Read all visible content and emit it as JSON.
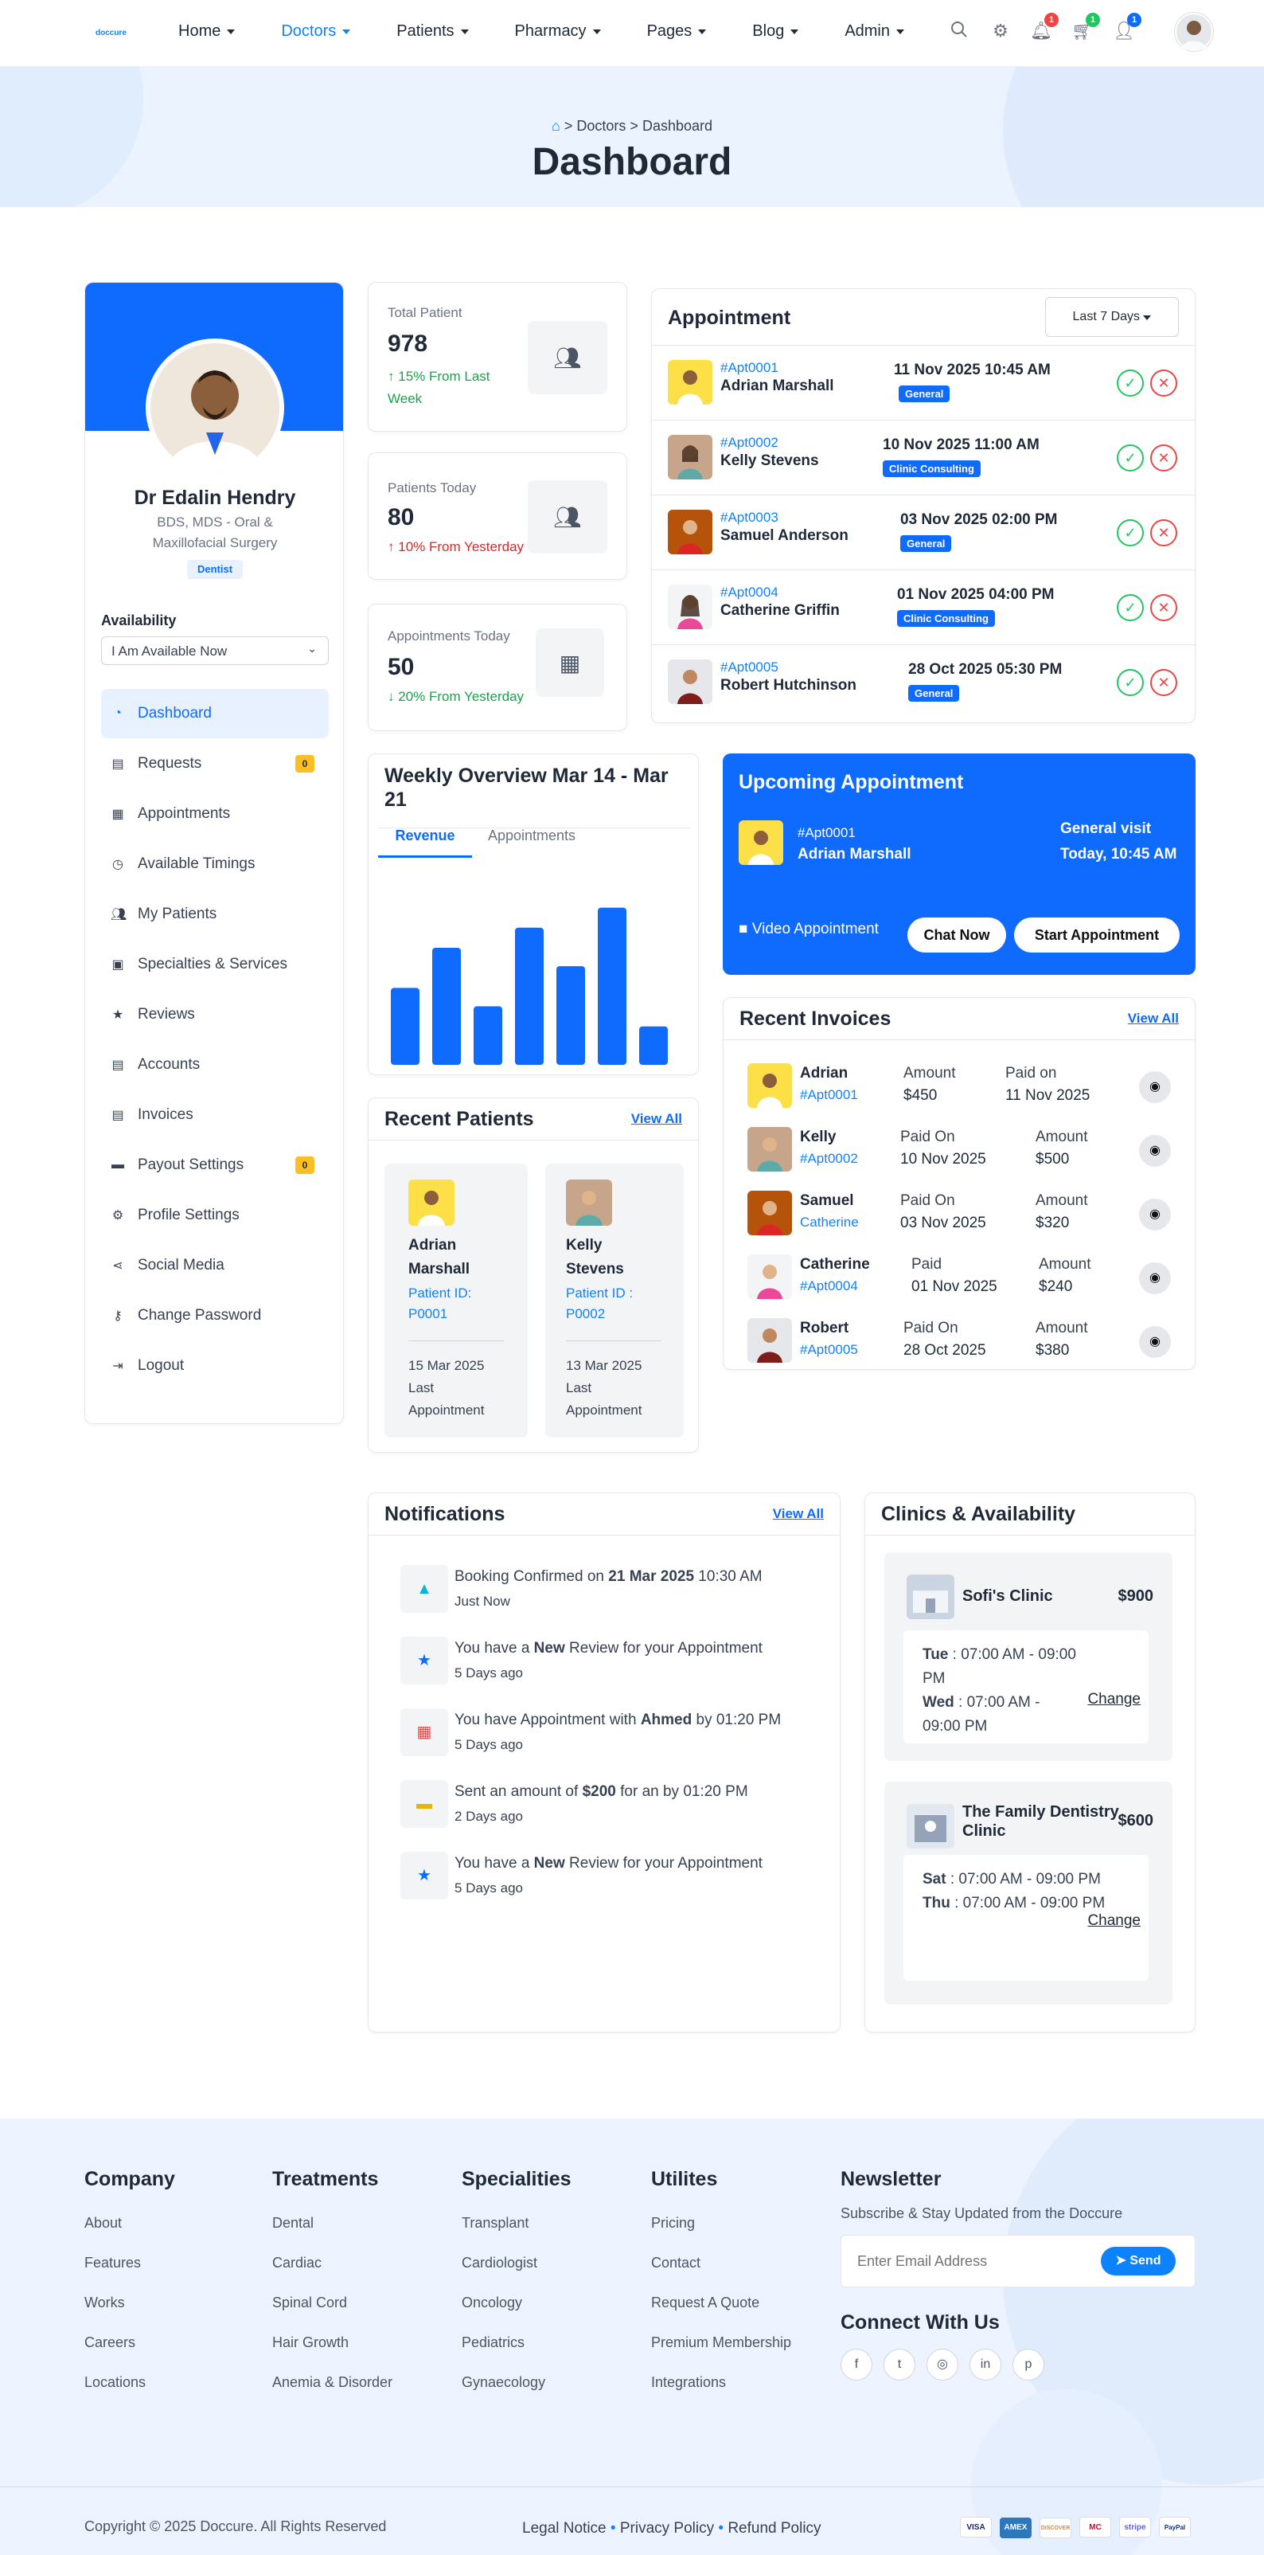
{
  "nav": {
    "logo": "doccure",
    "items": [
      {
        "label": "Home"
      },
      {
        "label": "Doctors"
      },
      {
        "label": "Patients"
      },
      {
        "label": "Pharmacy"
      },
      {
        "label": "Pages"
      },
      {
        "label": "Blog"
      },
      {
        "label": "Admin"
      }
    ],
    "badges": {
      "notifications": "1",
      "cart": "1",
      "messages": "1"
    }
  },
  "breadcrumb": {
    "doctors": "Doctors",
    "sep": ">",
    "dashboard": "Dashboard"
  },
  "page_title": "Dashboard",
  "profile": {
    "name": "Dr Edalin Hendry",
    "qualification": "BDS, MDS - Oral & Maxillofacial Surgery",
    "role": "Dentist",
    "availability_label": "Availability",
    "availability_value": "I Am Available Now"
  },
  "sidebar": {
    "items": [
      {
        "label": "Dashboard"
      },
      {
        "label": "Requests",
        "badge": "0"
      },
      {
        "label": "Appointments"
      },
      {
        "label": "Available Timings"
      },
      {
        "label": "My Patients"
      },
      {
        "label": "Specialties & Services"
      },
      {
        "label": "Reviews"
      },
      {
        "label": "Accounts"
      },
      {
        "label": "Invoices"
      },
      {
        "label": "Payout Settings",
        "badge": "0"
      },
      {
        "label": "Profile Settings"
      },
      {
        "label": "Social Media"
      },
      {
        "label": "Change Password"
      },
      {
        "label": "Logout"
      }
    ]
  },
  "stats": [
    {
      "label": "Total Patient",
      "value": "978",
      "change": "15% From Last Week"
    },
    {
      "label": "Patients Today",
      "value": "80",
      "change": "10% From Yesterday"
    },
    {
      "label": "Appointments Today",
      "value": "50",
      "change": "20% From Yesterday"
    }
  ],
  "appointments": {
    "title": "Appointment",
    "filter": "Last 7 Days",
    "rows": [
      {
        "id": "#Apt0001",
        "name": "Adrian Marshall",
        "date": "11 Nov 2025 10:45 AM",
        "tag": "General"
      },
      {
        "id": "#Apt0002",
        "name": "Kelly Stevens",
        "date": "10 Nov 2025 11:00 AM",
        "tag": "Clinic Consulting"
      },
      {
        "id": "#Apt0003",
        "name": "Samuel Anderson",
        "date": "03 Nov 2025 02:00 PM",
        "tag": "General"
      },
      {
        "id": "#Apt0004",
        "name": "Catherine Griffin",
        "date": "01 Nov 2025 04:00 PM",
        "tag": "Clinic Consulting"
      },
      {
        "id": "#Apt0005",
        "name": "Robert Hutchinson",
        "date": "28 Oct 2025 05:30 PM",
        "tag": "General"
      }
    ]
  },
  "weekly": {
    "title": "Weekly Overview Mar 14 - Mar 21",
    "tab_revenue": "Revenue",
    "tab_appointments": "Appointments"
  },
  "chart_data": {
    "type": "bar",
    "categories": [
      "",
      "",
      "",
      "",
      "",
      "",
      ""
    ],
    "values": [
      46,
      70,
      35,
      82,
      59,
      94,
      23
    ],
    "ylim": [
      0,
      100
    ],
    "title": "",
    "xlabel": "",
    "ylabel": ""
  },
  "upcoming": {
    "title": "Upcoming Appointment",
    "id": "#Apt0001",
    "name": "Adrian Marshall",
    "type": "General visit",
    "time": "Today, 10:45 AM",
    "mode": "Video Appointment",
    "chat": "Chat Now",
    "start": "Start Appointment"
  },
  "recent_patients": {
    "title": "Recent Patients",
    "view_all": "View All",
    "items": [
      {
        "first": "Adrian",
        "last": "Marshall",
        "id_label": "Patient ID:",
        "id": "P0001",
        "date": "15 Mar 2025",
        "last_label": "Last",
        "appt_label": "Appointment"
      },
      {
        "first": "Kelly",
        "last": "Stevens",
        "id_label": "Patient ID :",
        "id": "P0002",
        "date": "13 Mar 2025",
        "last_label": "Last",
        "appt_label": "Appointment"
      }
    ]
  },
  "invoices": {
    "title": "Recent Invoices",
    "view_all": "View All",
    "rows": [
      {
        "name": "Adrian",
        "sub": "#Apt0001",
        "l1": "Amount",
        "v1": "$450",
        "l2": "Paid on",
        "v2": "11 Nov 2025"
      },
      {
        "name": "Kelly",
        "sub": "#Apt0002",
        "l1": "Paid On",
        "v1": "10 Nov 2025",
        "l2": "Amount",
        "v2": "$500"
      },
      {
        "name": "Samuel",
        "sub": "Catherine",
        "l1": "Paid On",
        "v1": "03 Nov 2025",
        "l2": "Amount",
        "v2": "$320"
      },
      {
        "name": "Catherine",
        "sub": "#Apt0004",
        "l1": "Paid",
        "v1": "01 Nov 2025",
        "l2": "Amount",
        "v2": "$240"
      },
      {
        "name": "Robert",
        "sub": "#Apt0005",
        "l1": "Paid On",
        "v1": "28 Oct 2025",
        "l2": "Amount",
        "v2": "$380"
      }
    ]
  },
  "notifications": {
    "title": "Notifications",
    "view_all": "View All",
    "items": [
      {
        "a": "Booking Confirmed on ",
        "b": "21 Mar 2025",
        "c": " 10:30 AM",
        "time": "Just Now"
      },
      {
        "a": "You have a ",
        "b": "New",
        "c": " Review for your Appointment",
        "time": "5 Days ago"
      },
      {
        "a": "You have Appointment with ",
        "b": "Ahmed",
        "c": " by 01:20 PM",
        "time": "5 Days ago"
      },
      {
        "a": "Sent an amount of ",
        "b": "$200",
        "c": " for an by 01:20 PM",
        "time": "2 Days ago"
      },
      {
        "a": "You have a ",
        "b": "New",
        "c": " Review for your Appointment",
        "time": "5 Days ago"
      }
    ]
  },
  "clinics": {
    "title": "Clinics & Availability",
    "items": [
      {
        "name": "Sofi's Clinic",
        "price": "$900",
        "d1": "Tue",
        "t1": " : 07:00 AM - 09:00 PM",
        "d2": "Wed",
        "t2": " : 07:00 AM - 09:00 PM",
        "change": "Change"
      },
      {
        "name": "The Family Dentistry Clinic",
        "price": "$600",
        "d1": "Sat",
        "t1": " : 07:00 AM - 09:00 PM",
        "d2": "Thu",
        "t2": " : 07:00 AM - 09:00 PM",
        "change": "Change"
      }
    ]
  },
  "footer": {
    "company": {
      "title": "Company",
      "links": [
        "About",
        "Features",
        "Works",
        "Careers",
        "Locations"
      ]
    },
    "treatments": {
      "title": "Treatments",
      "links": [
        "Dental",
        "Cardiac",
        "Spinal Cord",
        "Hair Growth",
        "Anemia & Disorder"
      ]
    },
    "specialities": {
      "title": "Specialities",
      "links": [
        "Transplant",
        "Cardiologist",
        "Oncology",
        "Pediatrics",
        "Gynaecology"
      ]
    },
    "utilities": {
      "title": "Utilites",
      "links": [
        "Pricing",
        "Contact",
        "Request A Quote",
        "Premium Membership",
        "Integrations"
      ]
    },
    "newsletter": {
      "title": "Newsletter",
      "text": "Subscribe & Stay Updated from the Doccure",
      "placeholder": "Enter Email Address",
      "send": "Send"
    },
    "connect": "Connect With Us",
    "copyright": "Copyright © 2025 Doccure. All Rights Reserved",
    "legal": "Legal Notice",
    "privacy": "Privacy Policy",
    "refund": "Refund Policy",
    "payments": [
      "VISA",
      "AMEX",
      "DISCOVER",
      "MC",
      "stripe",
      "PayPal"
    ]
  },
  "colors": {
    "primary": "#0e6bfd",
    "link": "#0e82fd",
    "success": "#22c55e",
    "danger": "#ef4444",
    "warning": "#fbbf24"
  }
}
